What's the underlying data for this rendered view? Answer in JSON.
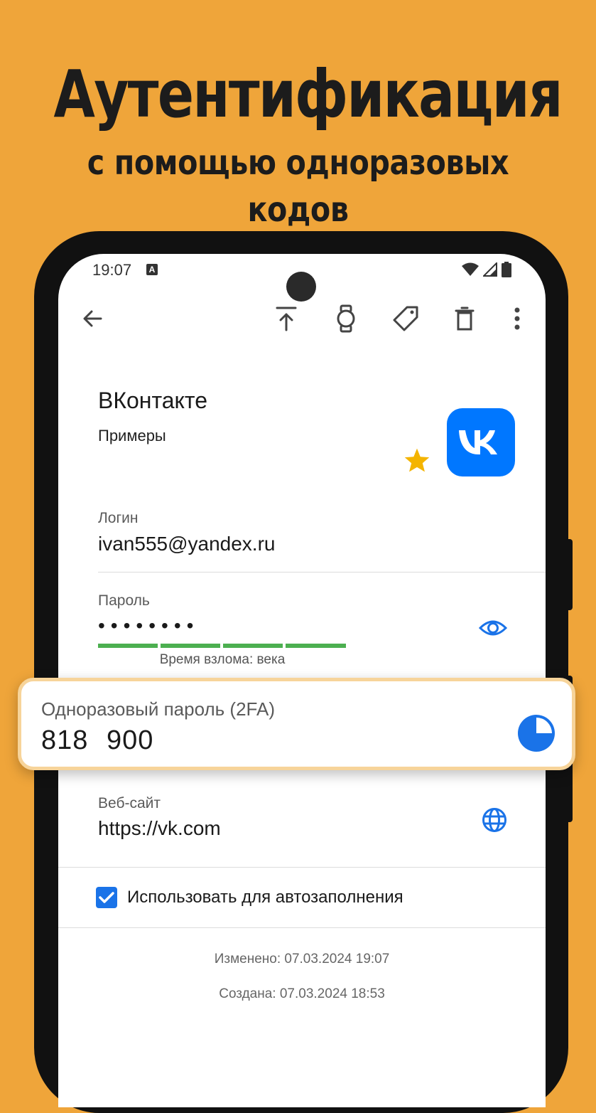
{
  "promo": {
    "title": "Аутентификация",
    "subtitle": "с помощью одноразовых кодов"
  },
  "status_bar": {
    "time": "19:07",
    "notification_letter": "A",
    "icons": [
      "wifi-icon",
      "signal-icon",
      "battery-icon"
    ]
  },
  "toolbar": {
    "icons": [
      "back-arrow-icon",
      "upload-icon",
      "watch-icon",
      "tag-icon",
      "trash-icon",
      "more-vertical-icon"
    ]
  },
  "entry": {
    "title": "ВКонтакте",
    "group": "Примеры",
    "favorite": true,
    "logo_text": "VK",
    "logo_color": "#0077FF"
  },
  "login": {
    "label": "Логин",
    "value": "ivan555@yandex.ru"
  },
  "password": {
    "label": "Пароль",
    "masked_value": "••••••••",
    "strength_segments": 4,
    "crack_time": "Время взлома: века"
  },
  "otp": {
    "label": "Одноразовый пароль (2FA)",
    "code": "818 900",
    "timer_remaining_fraction": 0.75
  },
  "website": {
    "label": "Веб-сайт",
    "value": "https://vk.com"
  },
  "autofill": {
    "checked": true,
    "label": "Использовать для автозаполнения"
  },
  "meta": {
    "modified": "Изменено: 07.03.2024 19:07",
    "created": "Создана: 07.03.2024 18:53"
  },
  "colors": {
    "background": "#EFA53A",
    "accent": "#1a73e8",
    "strength": "#4CAF50",
    "star": "#F4B400"
  }
}
